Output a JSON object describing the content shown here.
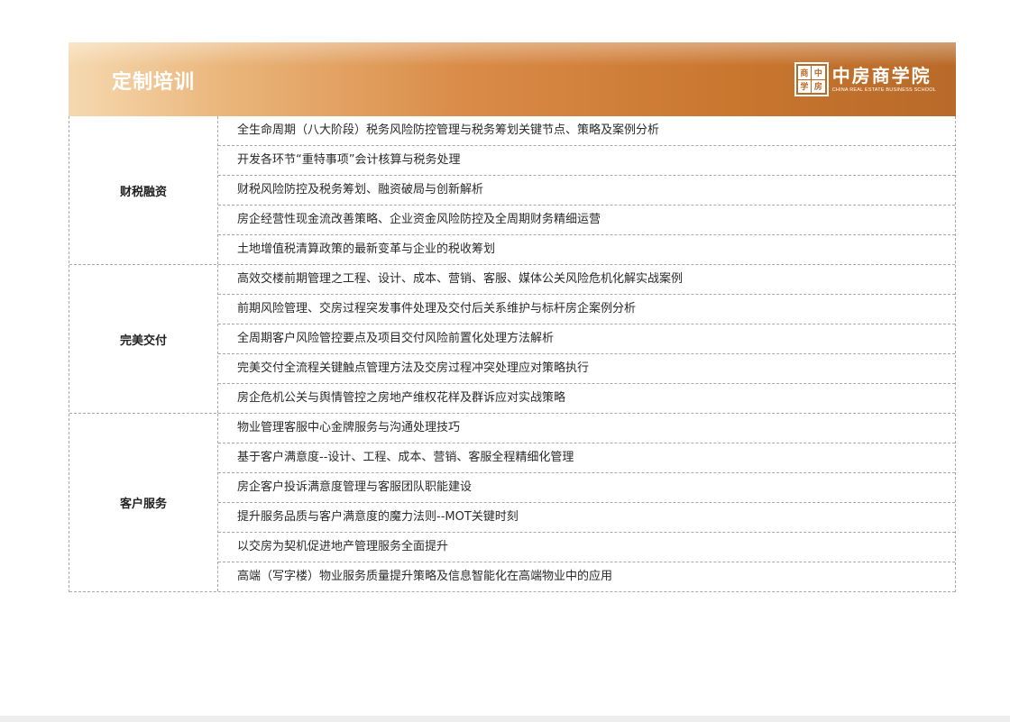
{
  "header": {
    "title": "定制培训",
    "logo": {
      "seal_chars": [
        "商",
        "中",
        "学",
        "房"
      ],
      "name_cn": "中房商学院",
      "name_en": "CHINA REAL ESTATE BUSINESS SCHOOL"
    }
  },
  "groups": [
    {
      "category": "财税融资",
      "items": [
        "全生命周期（八大阶段）税务风险防控管理与税务筹划关键节点、策略及案例分析",
        "开发各环节“重特事项”会计核算与税务处理",
        "财税风险防控及税务筹划、融资破局与创新解析",
        "房企经营性现金流改善策略、企业资金风险防控及全周期财务精细运营",
        "土地增值税清算政策的最新变革与企业的税收筹划"
      ]
    },
    {
      "category": "完美交付",
      "items": [
        "高效交楼前期管理之工程、设计、成本、营销、客服、媒体公关风险危机化解实战案例",
        "前期风险管理、交房过程突发事件处理及交付后关系维护与标杆房企案例分析",
        "全周期客户风险管控要点及项目交付风险前置化处理方法解析",
        "完美交付全流程关键触点管理方法及交房过程冲突处理应对策略执行",
        "房企危机公关与舆情管控之房地产维权花样及群诉应对实战策略"
      ]
    },
    {
      "category": "客户服务",
      "items": [
        "物业管理客服中心金牌服务与沟通处理技巧",
        "基于客户满意度--设计、工程、成本、营销、客服全程精细化管理",
        "房企客户投诉满意度管理与客服团队职能建设",
        "提升服务品质与客户满意度的魔力法则--MOT关键时刻",
        "以交房为契机促进地产管理服务全面提升",
        "高端（写字楼）物业服务质量提升策略及信息智能化在高端物业中的应用"
      ]
    }
  ],
  "colors": {
    "header_gradient_start": "#f6d9b0",
    "header_gradient_end": "#b86a28",
    "border": "#a9a9a9"
  }
}
